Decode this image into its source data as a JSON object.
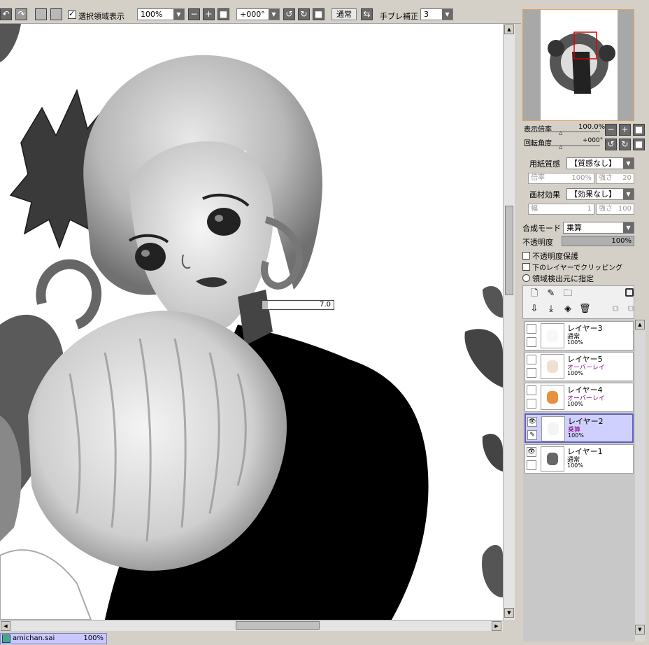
{
  "toolbar": {
    "selection_checkbox_label": "選択領域表示",
    "selection_checked": true,
    "zoom_value": "100%",
    "rotation_value": "+000°",
    "blend_button": "通常",
    "stabilizer_label": "手ブレ補正",
    "stabilizer_value": "3"
  },
  "canvas": {
    "brush_size_readout": "7.0"
  },
  "status": {
    "file_name": "amichan.sai",
    "file_zoom": "100%"
  },
  "navigator": {
    "zoom_label": "表示倍率",
    "zoom_value": "100.0%",
    "angle_label": "回転角度",
    "angle_value": "+000°"
  },
  "paper": {
    "texture_label": "用紙質感",
    "texture_value": "【質感なし】",
    "scale_label": "倍率",
    "scale_value": "100%",
    "strength_label": "強さ",
    "strength_value": "20"
  },
  "effect": {
    "label": "画材効果",
    "value": "【効果なし】",
    "width_label": "幅",
    "width_value": "1",
    "strength_label": "強さ",
    "strength_value": "100"
  },
  "blend": {
    "mode_label": "合成モード",
    "mode_value": "乗算",
    "opacity_label": "不透明度",
    "opacity_value": "100%",
    "opacity_fraction": 1.0
  },
  "options": {
    "preserve_opacity": "不透明度保護",
    "clip_below": "下のレイヤーでクリッピング",
    "selection_source": "領域検出元に指定"
  },
  "layers": [
    {
      "name": "レイヤー3",
      "mode": "通常",
      "opacity": "100%",
      "visible": false,
      "selected": false,
      "mode_color": "#000000"
    },
    {
      "name": "レイヤー5",
      "mode": "オーバーレイ",
      "opacity": "100%",
      "visible": false,
      "selected": false,
      "mode_color": "#800080"
    },
    {
      "name": "レイヤー4",
      "mode": "オーバーレイ",
      "opacity": "100%",
      "visible": false,
      "selected": false,
      "mode_color": "#800080"
    },
    {
      "name": "レイヤー2",
      "mode": "乗算",
      "opacity": "100%",
      "visible": true,
      "selected": true,
      "mode_color": "#800080"
    },
    {
      "name": "レイヤー1",
      "mode": "通常",
      "opacity": "100%",
      "visible": true,
      "selected": false,
      "mode_color": "#000000"
    }
  ],
  "icons": {
    "eye": "👁",
    "pen": "✎"
  }
}
